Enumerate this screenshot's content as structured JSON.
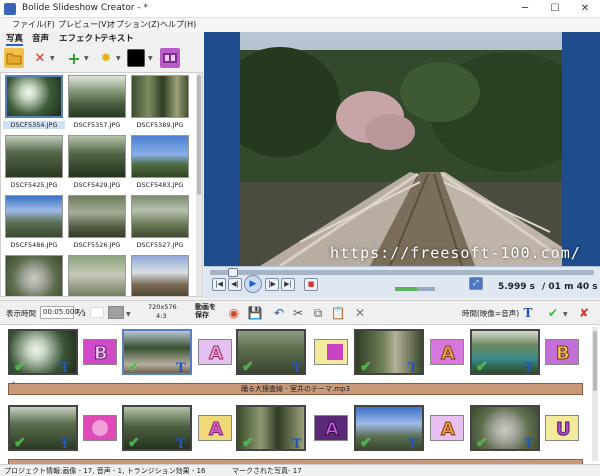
{
  "window": {
    "title": "Bolide Slideshow Creator - *"
  },
  "menu": [
    "ファイル(F)",
    "プレビュー(V)",
    "オプション(Z)",
    "ヘルプ(H)"
  ],
  "tabs": [
    "写真",
    "音声",
    "エフェクト",
    "テキスト"
  ],
  "thumbnails": [
    "DSCF5354.JPG",
    "DSCF5357.JPG",
    "DSCF5389.JPG",
    "DSCF5425.JPG",
    "DSCF5429.JPG",
    "DSCF5483.JPG",
    "DSCF5486.JPG",
    "DSCF5526.JPG",
    "DSCF5527.JPG"
  ],
  "colors": {
    "accent": "#2a62c9",
    "preview_bg": "#1f4c8c",
    "audio": "#c9997a",
    "check": "#3fb63f"
  },
  "preview": {
    "watermark": "https://freesoft-100.com/"
  },
  "player": {
    "position_seconds": "5.999 s",
    "total_duration": "/ 01 m 40 s",
    "progress_fraction": 0.06,
    "volume_fraction": 0.55
  },
  "timeline_toolbar": {
    "display_time_label": "表示時間",
    "display_time_value": "00:05.000",
    "resolution": "720x576",
    "aspect": "4:3",
    "save_video_label": "動画を\n保存",
    "time_mode_label": "時間(映像=音声)"
  },
  "audio_track": {
    "label": "踊る大捜査線 - 室井のテーマ.mp3"
  },
  "statusbar": {
    "project_info": "プロジェクト情報:画像 - 17, 音声 - 1, トランジション効果 - 16",
    "marked_photos": "マークされた写真- 17"
  }
}
